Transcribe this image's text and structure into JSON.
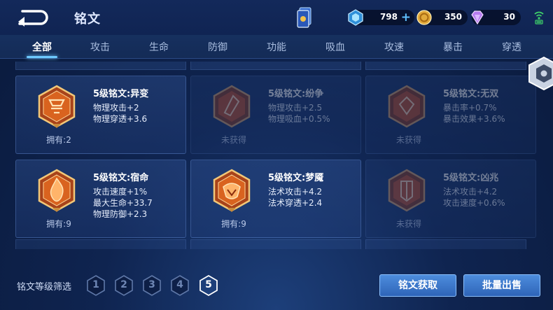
{
  "header": {
    "title": "铭文",
    "currencies": {
      "diamond": "798",
      "gold": "350",
      "gem": "30"
    }
  },
  "tabs": [
    {
      "label": "全部",
      "active": true
    },
    {
      "label": "攻击"
    },
    {
      "label": "生命"
    },
    {
      "label": "防御"
    },
    {
      "label": "功能"
    },
    {
      "label": "吸血"
    },
    {
      "label": "攻速"
    },
    {
      "label": "暴击"
    },
    {
      "label": "穿透"
    }
  ],
  "runes": [
    {
      "name": "5级铭文:异变",
      "stats": [
        "物理攻击+2",
        "物理穿透+3.6"
      ],
      "count": "拥有:2",
      "owned": true,
      "color": "#d9631f"
    },
    {
      "name": "5级铭文:纷争",
      "stats": [
        "物理攻击+2.5",
        "物理吸血+0.5%"
      ],
      "count": "未获得",
      "owned": false,
      "color": "#c2502a"
    },
    {
      "name": "5级铭文:无双",
      "stats": [
        "暴击率+0.7%",
        "暴击效果+3.6%"
      ],
      "count": "未获得",
      "owned": false,
      "color": "#c2502a"
    },
    {
      "name": "5级铭文:宿命",
      "stats": [
        "攻击速度+1%",
        "最大生命+33.7",
        "物理防御+2.3"
      ],
      "count": "拥有:9",
      "owned": true,
      "color": "#d9631f"
    },
    {
      "name": "5级铭文:梦魇",
      "stats": [
        "法术攻击+4.2",
        "法术穿透+2.4"
      ],
      "count": "拥有:9",
      "owned": true,
      "color": "#d9631f"
    },
    {
      "name": "5级铭文:凶兆",
      "stats": [
        "法术攻击+4.2",
        "攻击速度+0.6%"
      ],
      "count": "未获得",
      "owned": false,
      "color": "#c2502a"
    }
  ],
  "filter": {
    "label": "铭文等级筛选",
    "levels": [
      "1",
      "2",
      "3",
      "4",
      "5"
    ],
    "active_level": "5"
  },
  "buttons": {
    "obtain": "铭文获取",
    "sell": "批量出售"
  },
  "colors": {
    "accent": "#6ec9ff",
    "rune_orange": "#d9631f",
    "button_blue": "#3b78cc"
  }
}
